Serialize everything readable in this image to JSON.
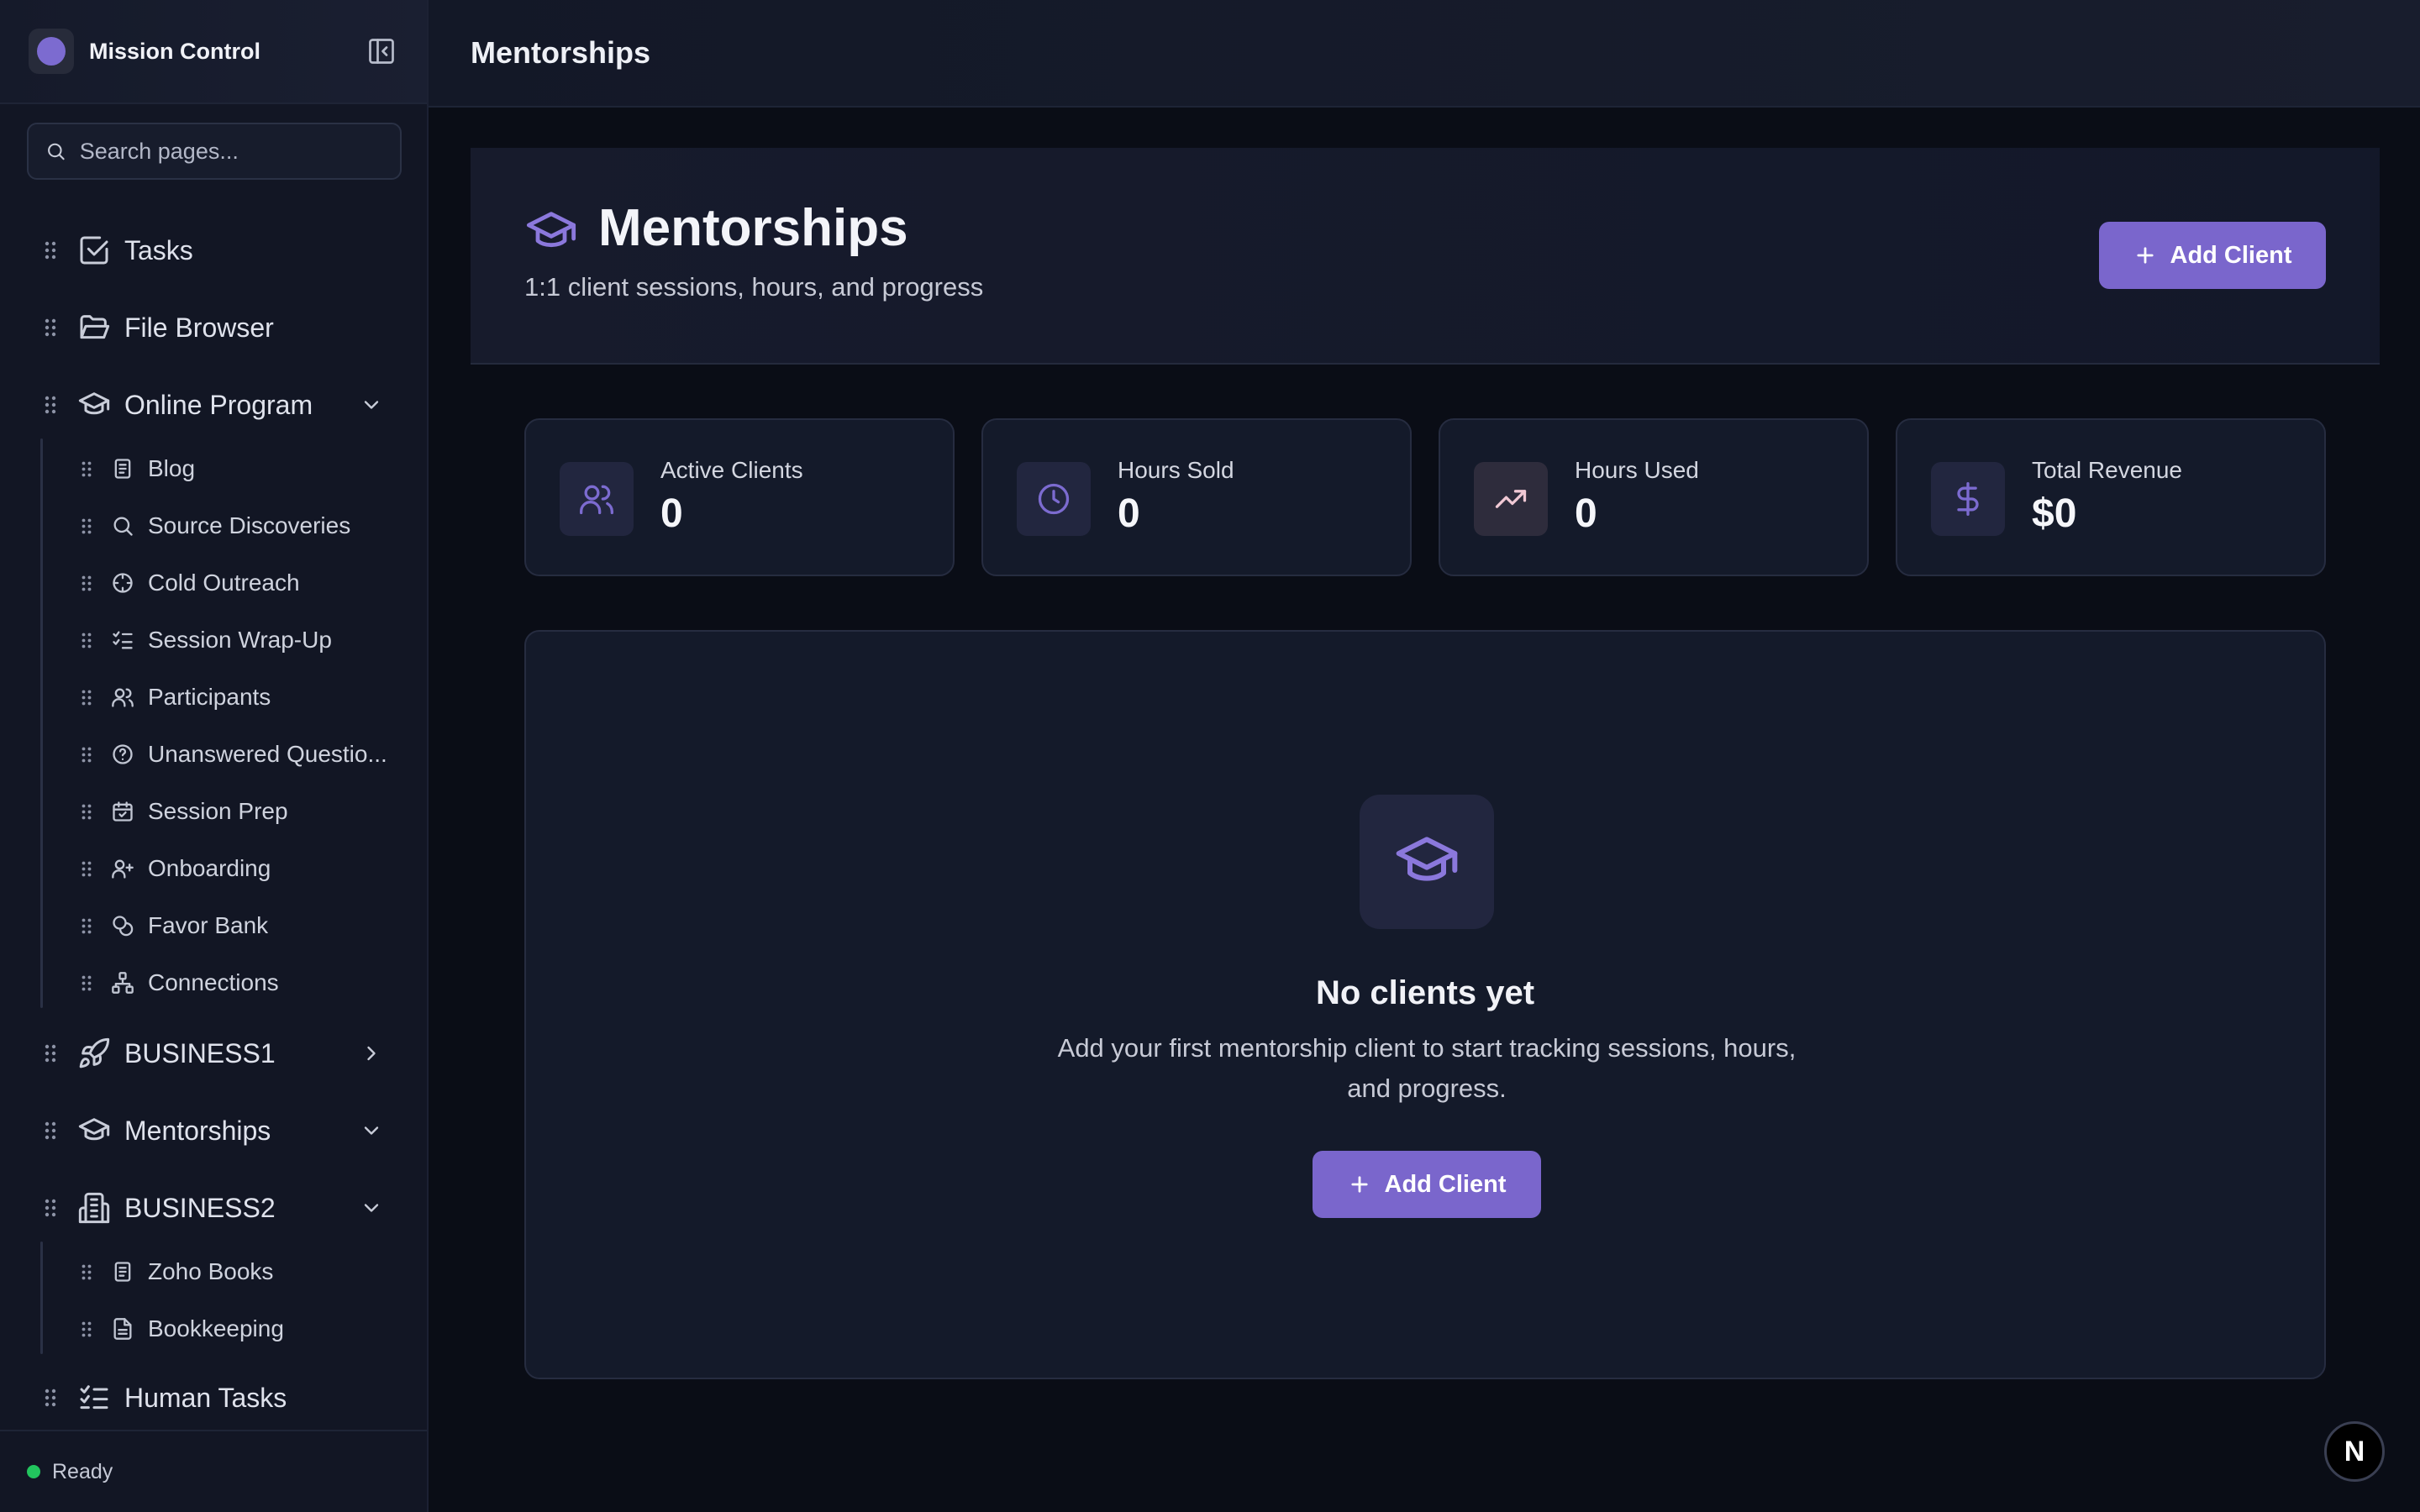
{
  "app": {
    "title": "Mission Control"
  },
  "search": {
    "placeholder": "Search pages..."
  },
  "sidebar": {
    "items": [
      {
        "label": "Tasks"
      },
      {
        "label": "File Browser"
      },
      {
        "label": "Online Program",
        "children": [
          {
            "label": "Blog"
          },
          {
            "label": "Source Discoveries"
          },
          {
            "label": "Cold Outreach"
          },
          {
            "label": "Session Wrap-Up"
          },
          {
            "label": "Participants"
          },
          {
            "label": "Unanswered Questio..."
          },
          {
            "label": "Session Prep"
          },
          {
            "label": "Onboarding"
          },
          {
            "label": "Favor Bank"
          },
          {
            "label": "Connections"
          }
        ]
      },
      {
        "label": "BUSINESS1"
      },
      {
        "label": "Mentorships"
      },
      {
        "label": "BUSINESS2",
        "children": [
          {
            "label": "Zoho Books"
          },
          {
            "label": "Bookkeeping"
          }
        ]
      },
      {
        "label": "Human Tasks"
      }
    ],
    "status": "Ready"
  },
  "topbar": {
    "title": "Mentorships"
  },
  "page_header": {
    "title": "Mentorships",
    "subtitle": "1:1 client sessions, hours, and progress",
    "add_button": "Add Client"
  },
  "stats": [
    {
      "label": "Active Clients",
      "value": "0",
      "icon": "users-icon"
    },
    {
      "label": "Hours Sold",
      "value": "0",
      "icon": "clock-icon"
    },
    {
      "label": "Hours Used",
      "value": "0",
      "icon": "trending-up-icon"
    },
    {
      "label": "Total Revenue",
      "value": "$0",
      "icon": "dollar-icon"
    }
  ],
  "empty_state": {
    "title": "No clients yet",
    "description": "Add your first mentorship client to start tracking sessions, hours, and progress.",
    "button": "Add Client"
  },
  "corner_badge": "N",
  "colors": {
    "accent": "#7a66cc",
    "status_ok": "#22c55e",
    "background": "#0a0d16",
    "sidebar": "#121624"
  }
}
